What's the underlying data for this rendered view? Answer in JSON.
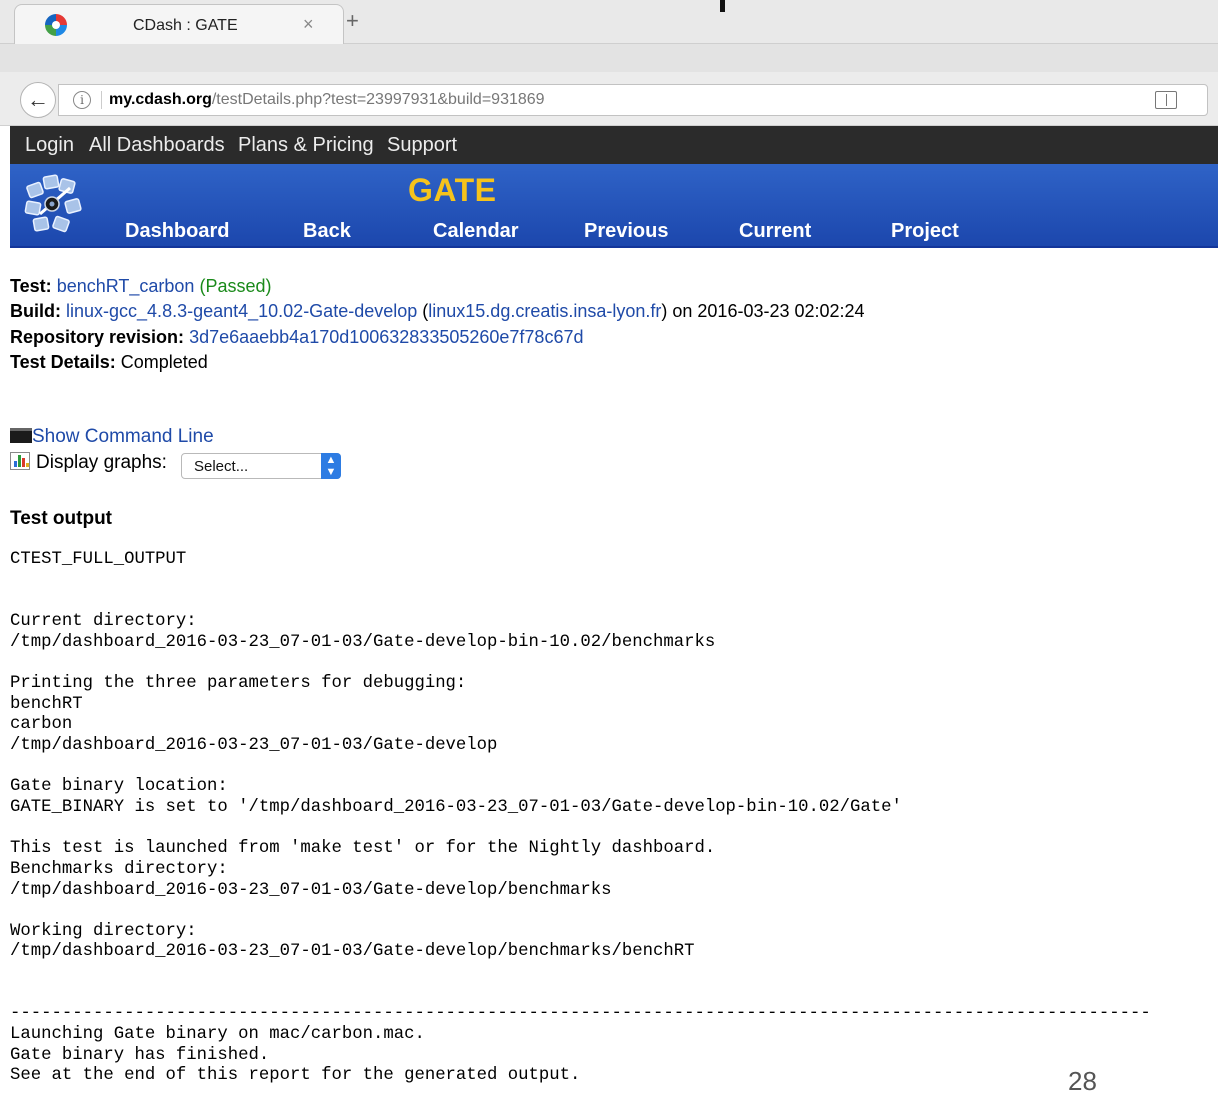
{
  "browser": {
    "tab_title": "CDash : GATE",
    "tab_close": "×",
    "new_tab": "+",
    "url_host": "my.cdash.org",
    "url_path": "/testDetails.php?test=23997931&build=931869"
  },
  "topnav": [
    "Login",
    "All Dashboards",
    "Plans & Pricing",
    "Support"
  ],
  "header": {
    "project": "GATE",
    "menu": [
      "Dashboard",
      "Back",
      "Calendar",
      "Previous",
      "Current",
      "Project"
    ]
  },
  "info": {
    "test_label": "Test:",
    "test_name": "benchRT_carbon",
    "test_status": "(Passed)",
    "build_label": "Build:",
    "build_name": "linux-gcc_4.8.3-geant4_10.02-Gate-develop",
    "build_open": " (",
    "build_site": "linux15.dg.creatis.insa-lyon.fr",
    "build_on": ") on 2016-03-23 02:02:24",
    "revision_label": "Repository revision:",
    "revision": "3d7e6aaebb4a170d100632833505260e7f78c67d",
    "details_label": "Test Details:",
    "details": "Completed"
  },
  "controls": {
    "show_command": "Show Command Line",
    "display_graphs": "Display graphs:",
    "select_value": "Select..."
  },
  "section_title": "Test output",
  "output_lines": [
    "CTEST_FULL_OUTPUT",
    "",
    "",
    "Current directory:",
    "/tmp/dashboard_2016-03-23_07-01-03/Gate-develop-bin-10.02/benchmarks",
    "",
    "Printing the three parameters for debugging:",
    "benchRT",
    "carbon",
    "/tmp/dashboard_2016-03-23_07-01-03/Gate-develop",
    "",
    "Gate binary location:",
    "GATE_BINARY is set to '/tmp/dashboard_2016-03-23_07-01-03/Gate-develop-bin-10.02/Gate'",
    "",
    "This test is launched from 'make test' or for the Nightly dashboard.",
    "Benchmarks directory:",
    "/tmp/dashboard_2016-03-23_07-01-03/Gate-develop/benchmarks",
    "",
    "Working directory:",
    "/tmp/dashboard_2016-03-23_07-01-03/Gate-develop/benchmarks/benchRT",
    "",
    "",
    "--------------------------------------------------------------------------------------------------------------",
    "Launching Gate binary on mac/carbon.mac.",
    "Gate binary has finished.",
    "See at the end of this report for the generated output."
  ],
  "page_number": "28"
}
